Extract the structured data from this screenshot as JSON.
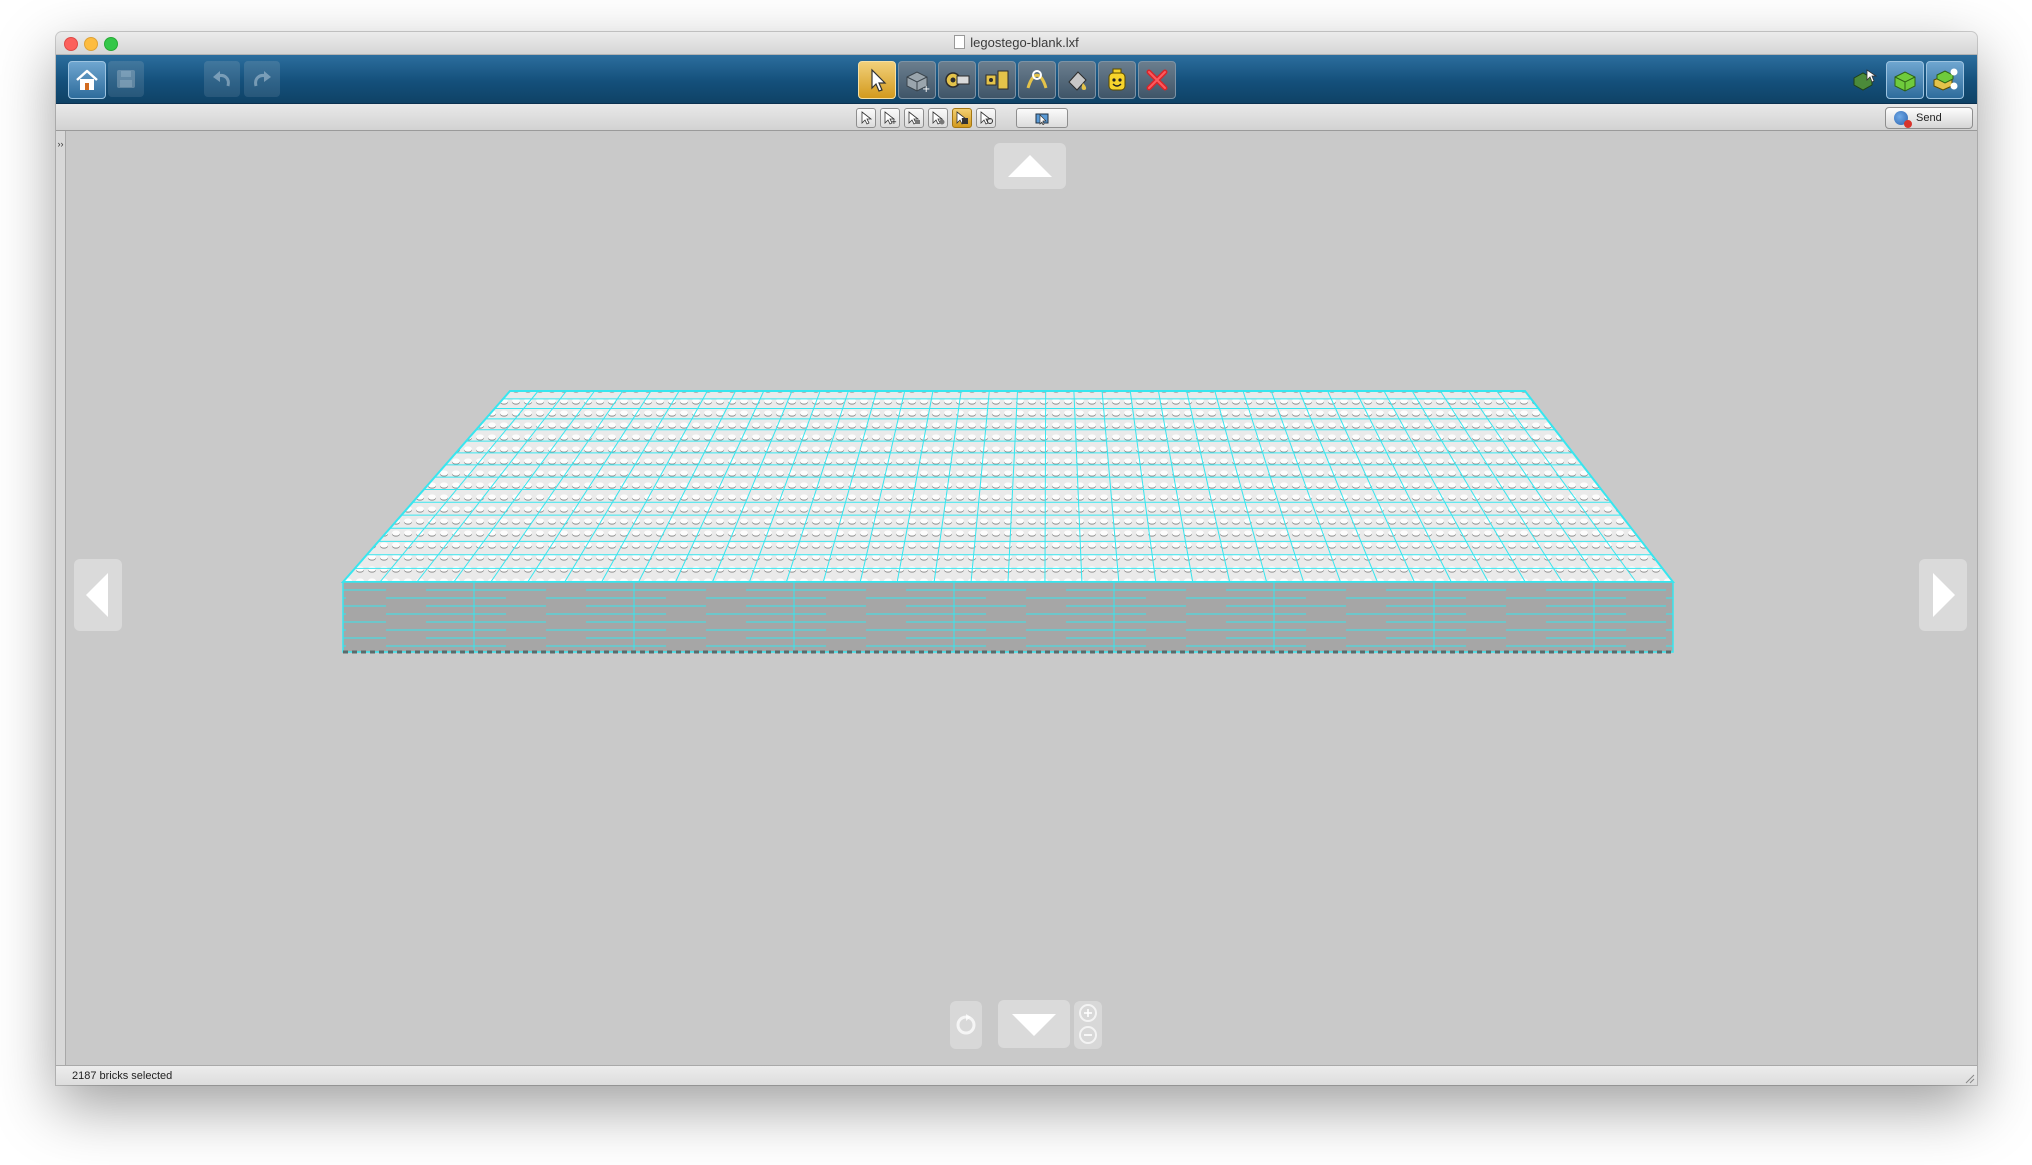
{
  "window": {
    "title": "legostego-blank.lxf",
    "file_icon": "document-icon"
  },
  "toolbar": {
    "left_buttons": [
      {
        "name": "home-button",
        "icon": "home-icon"
      },
      {
        "name": "save-button",
        "icon": "floppy-disk-icon"
      },
      {
        "name": "undo-button",
        "icon": "undo-arrow-icon"
      },
      {
        "name": "redo-button",
        "icon": "redo-arrow-icon"
      }
    ],
    "center_tools": [
      {
        "name": "select-tool",
        "icon": "cursor-arrow-icon",
        "active": true
      },
      {
        "name": "clone-tool",
        "icon": "clone-brick-icon"
      },
      {
        "name": "hinge-tool",
        "icon": "hinge-icon"
      },
      {
        "name": "hinge-align-tool",
        "icon": "hinge-align-icon"
      },
      {
        "name": "flex-tool",
        "icon": "flex-tool-icon"
      },
      {
        "name": "paint-tool",
        "icon": "paint-bucket-icon"
      },
      {
        "name": "decorate-tool",
        "icon": "minifig-head-icon"
      },
      {
        "name": "delete-tool",
        "icon": "red-x-delete-icon"
      }
    ],
    "right_buttons": [
      {
        "name": "brick-mode-button",
        "icon": "brick-cursor-icon"
      },
      {
        "name": "view-mode-button",
        "icon": "green-brick-icon"
      },
      {
        "name": "build-guide-button",
        "icon": "build-guide-icon"
      }
    ]
  },
  "subtoolbar": {
    "select_modes": [
      {
        "name": "single-select",
        "active": false
      },
      {
        "name": "multi-select",
        "active": false
      },
      {
        "name": "connected-select",
        "active": false
      },
      {
        "name": "same-color-select",
        "active": false
      },
      {
        "name": "same-brick-select",
        "active": true
      },
      {
        "name": "invert-select",
        "active": false
      }
    ],
    "send_label": "Send"
  },
  "colors": {
    "toolbar": "#14507b",
    "viewport": "#c9c9c9",
    "selection_outline": "#37e6ef",
    "active_tool": "#e0ad3a",
    "delete_red": "#d8262a"
  },
  "status": {
    "text": "2187 bricks selected"
  }
}
